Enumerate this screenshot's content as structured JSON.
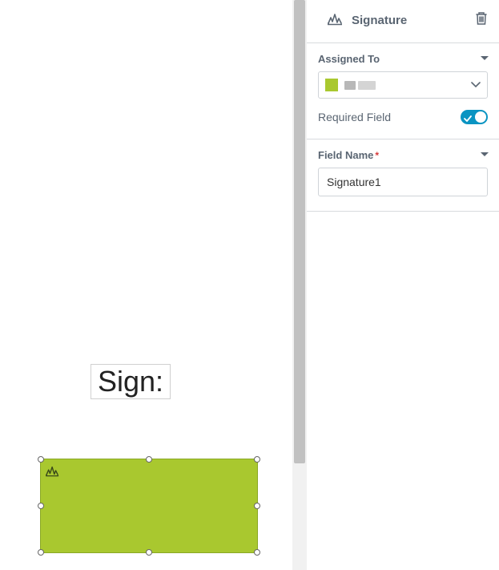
{
  "canvas": {
    "sign_label": "Sign:",
    "field_color": "#a9c82f"
  },
  "panel": {
    "title": "Signature",
    "sections": {
      "assigned_to": {
        "label": "Assigned To",
        "selected_swatch": "#a9c82f",
        "selected_text": ""
      },
      "required": {
        "label": "Required Field",
        "value": true
      },
      "field_name": {
        "label": "Field Name",
        "required": true,
        "value": "Signature1"
      }
    }
  }
}
